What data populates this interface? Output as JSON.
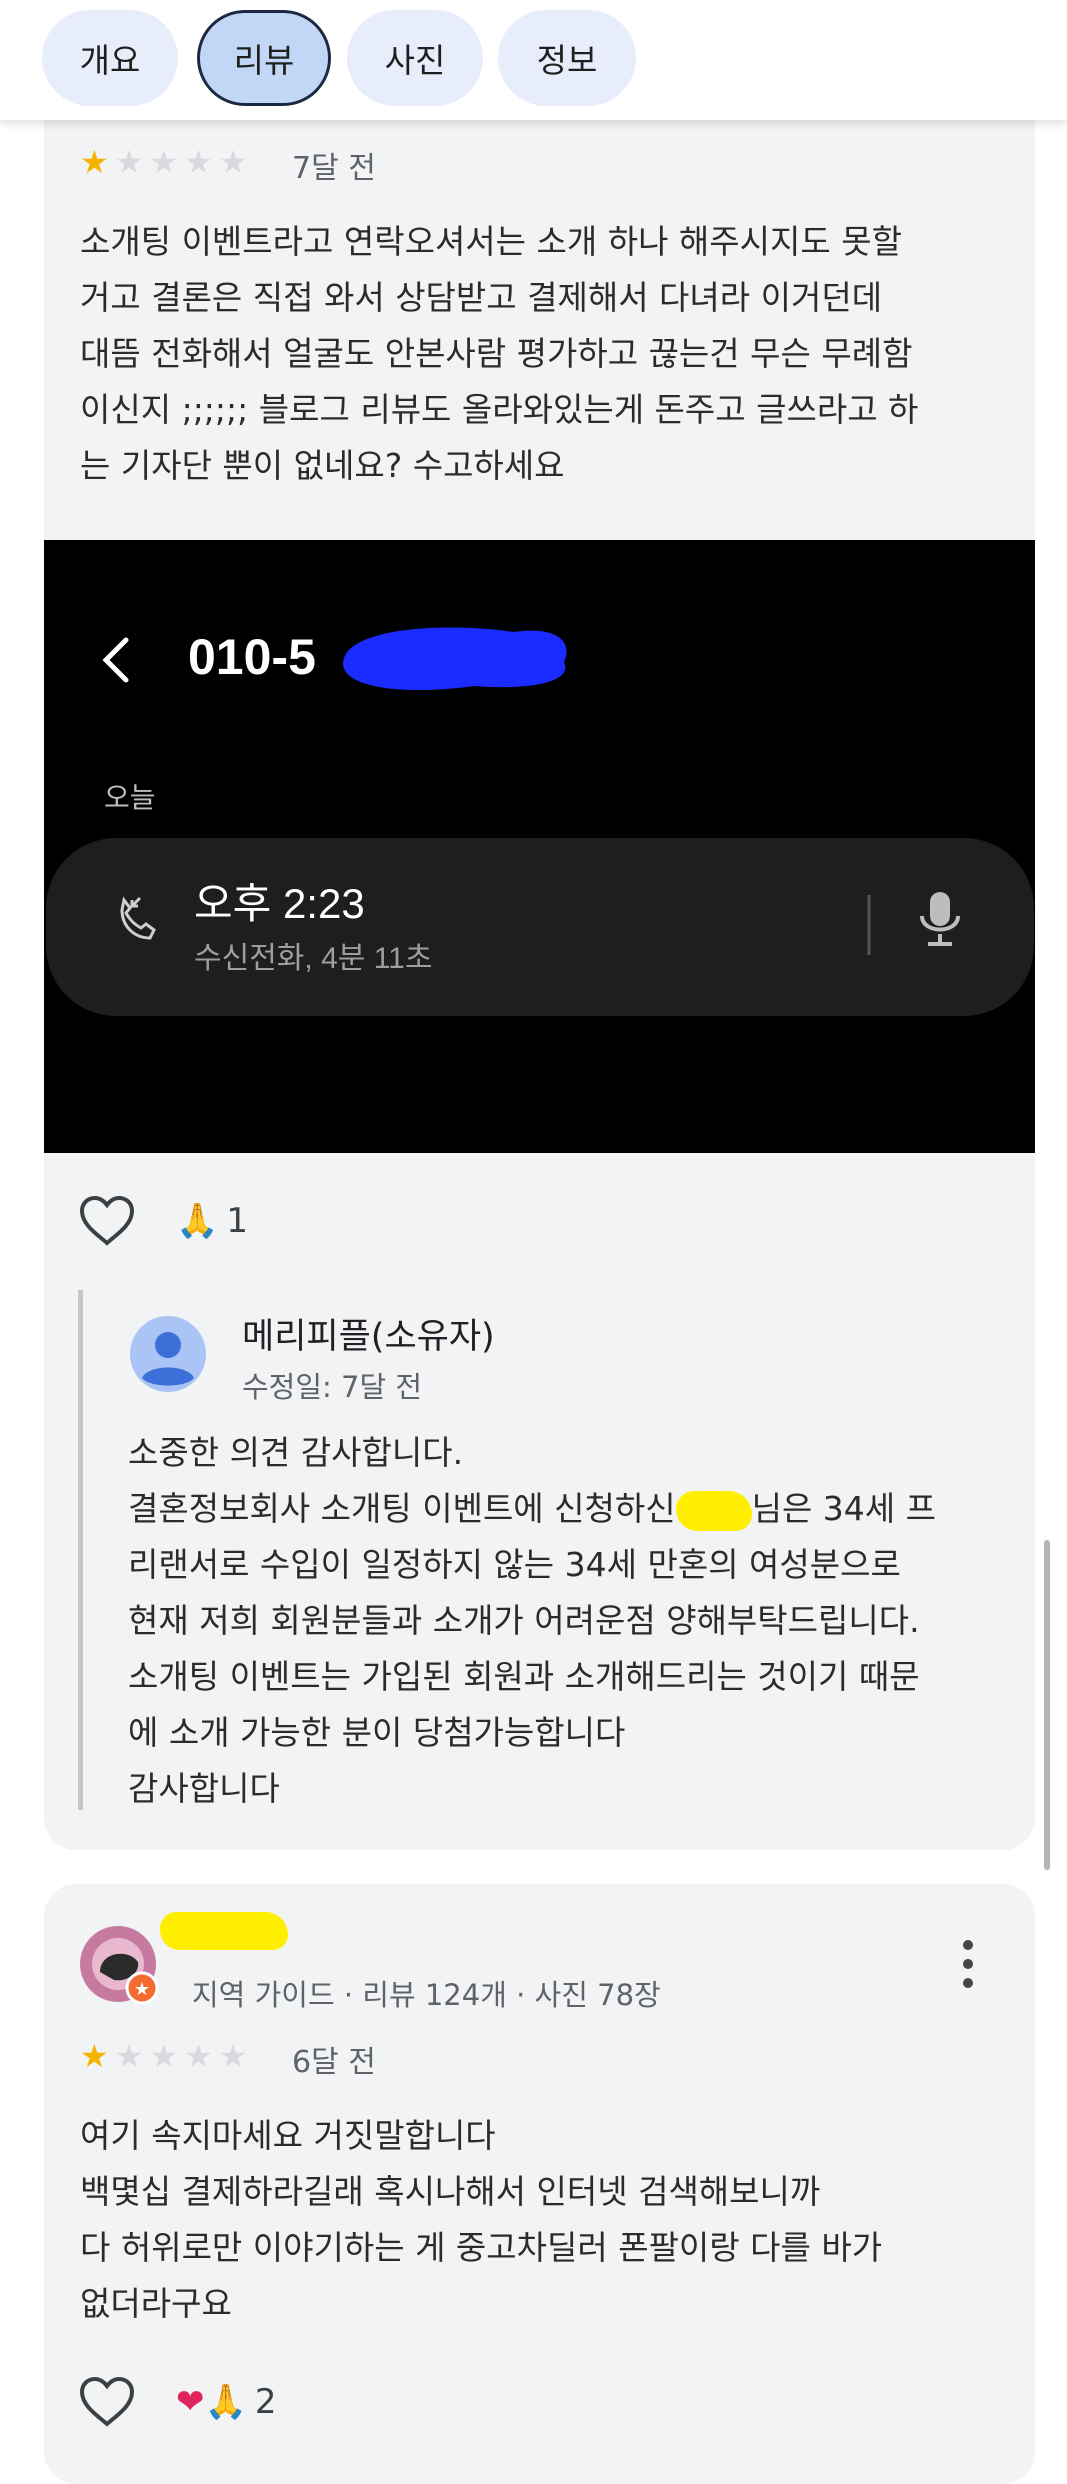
{
  "tabs": [
    {
      "label": "개요",
      "active": false
    },
    {
      "label": "리뷰",
      "active": true
    },
    {
      "label": "사진",
      "active": false
    },
    {
      "label": "정보",
      "active": false
    }
  ],
  "review1": {
    "rating": 1,
    "max_rating": 5,
    "time": "7달 전",
    "text": "소개팅 이벤트라고 연락오셔서는 소개 하나 해주시지도 못할\n거고 결론은 직접 와서 상담받고 결제해서 다녀라 이거던데\n대뜸 전화해서 얼굴도 안본사람 평가하고 끊는건 무슨 무례함\n이신지 ;;;;;; 블로그 리뷰도 올라와있는게 돈주고 글쓰라고 하\n는 기자단 뿐이 없네요? 수고하세요",
    "photo": {
      "phone_number_visible": "010-5",
      "section_label": "오늘",
      "call_time": "오후 2:23",
      "call_detail": "수신전화, 4분 11초"
    },
    "reaction_count": "1",
    "owner_reply": {
      "name": "메리피플(소유자)",
      "edited": "수정일: 7달 전",
      "lines": [
        "소중한 의견 감사합니다.",
        "결혼정보회사 소개팅 이벤트에 신청하신",
        "님은 34세 프",
        "리랜서로 수입이 일정하지 않는 34세 만혼의 여성분으로",
        "현재 저희 회원분들과 소개가 어려운점 양해부탁드립니다.",
        "소개팅 이벤트는 가입된 회원과 소개해드리는 것이기 때문",
        "에 소개 가능한 분이 당첨가능합니다",
        "감사합니다"
      ]
    }
  },
  "review2": {
    "reviewer_meta": "지역 가이드 · 리뷰 124개 · 사진 78장",
    "rating": 1,
    "max_rating": 5,
    "time": "6달 전",
    "text": "여기 속지마세요 거짓말합니다\n백몇십 결제하라길래 혹시나해서 인터넷 검색해보니까\n다 허위로만 이야기하는 게 중고차딜러 폰팔이랑 다를 바가\n없더라구요",
    "reaction_count": "2"
  },
  "icons": {
    "like": "heart-outline-icon",
    "pray": "folded-hands-emoji",
    "heart": "red-heart-emoji",
    "more": "more-vert-icon",
    "back": "chevron-left-icon",
    "call": "incoming-call-icon",
    "mic": "microphone-icon",
    "avatar": "default-person-avatar",
    "guide_badge": "local-guide-star-badge"
  },
  "colors": {
    "star_filled": "#f5b400",
    "star_empty": "#d8dade",
    "chip_bg": "#e8edfb",
    "chip_active_bg": "#c2d7f5",
    "redaction_blue": "#1a2cff",
    "redaction_yellow": "#ffee00"
  }
}
